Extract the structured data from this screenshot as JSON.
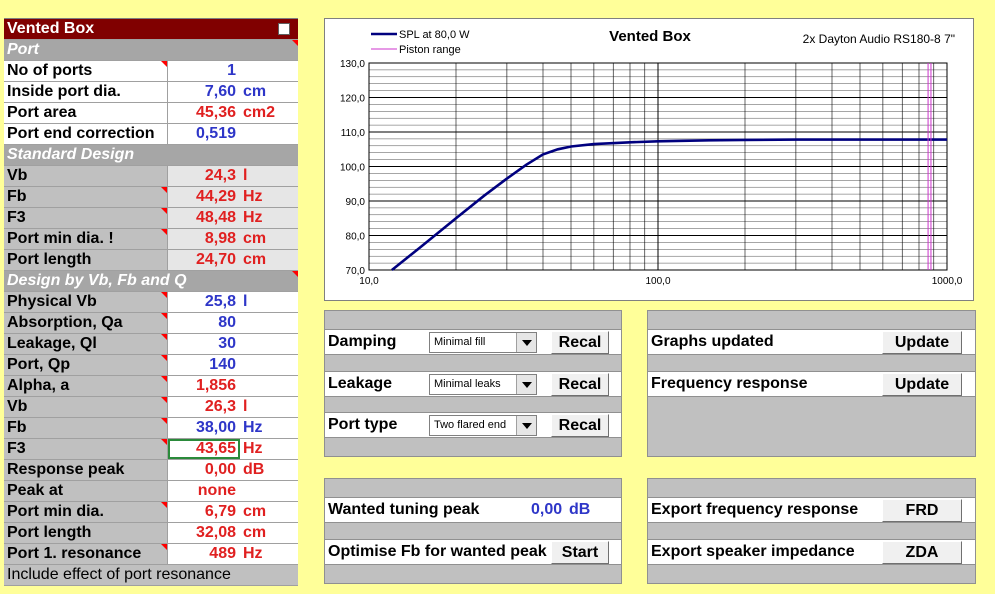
{
  "table": {
    "title": "Vented Box",
    "sections": {
      "port": "Port",
      "standard": "Standard Design",
      "design": "Design by Vb, Fb and Q"
    },
    "rows": [
      {
        "label": "No of ports",
        "value": "1",
        "unit": ""
      },
      {
        "label": "Inside port dia.",
        "value": "7,60",
        "unit": "cm"
      },
      {
        "label": "Port area",
        "value": "45,36",
        "unit": "cm2"
      },
      {
        "label": "Port end correction",
        "value": "0,519",
        "unit": ""
      },
      {
        "label": "Vb",
        "value": "24,3",
        "unit": "l"
      },
      {
        "label": "Fb",
        "value": "44,29",
        "unit": "Hz"
      },
      {
        "label": "F3",
        "value": "48,48",
        "unit": "Hz"
      },
      {
        "label": "Port min dia. !",
        "value": "8,98",
        "unit": "cm"
      },
      {
        "label": "Port length",
        "value": "24,70",
        "unit": "cm"
      },
      {
        "label": "Physical Vb",
        "value": "25,8",
        "unit": "l"
      },
      {
        "label": "Absorption, Qa",
        "value": "80",
        "unit": ""
      },
      {
        "label": "Leakage, Ql",
        "value": "30",
        "unit": ""
      },
      {
        "label": "Port, Qp",
        "value": "140",
        "unit": ""
      },
      {
        "label": "Alpha, a",
        "value": "1,856",
        "unit": ""
      },
      {
        "label": "Vb",
        "value": "26,3",
        "unit": "l"
      },
      {
        "label": "Fb",
        "value": "38,00",
        "unit": "Hz"
      },
      {
        "label": "F3",
        "value": "43,65",
        "unit": "Hz"
      },
      {
        "label": "Response peak",
        "value": "0,00",
        "unit": "dB"
      },
      {
        "label": "Peak at",
        "value": "none",
        "unit": ""
      },
      {
        "label": "Port min dia.",
        "value": "6,79",
        "unit": "cm"
      },
      {
        "label": "Port length",
        "value": "32,08",
        "unit": "cm"
      },
      {
        "label": "Port 1. resonance",
        "value": "489",
        "unit": "Hz"
      }
    ],
    "include_label": "Include effect of port resonance"
  },
  "chart": {
    "title": "Vented Box",
    "subtitle": "2x Dayton Audio RS180-8 7\"",
    "legend": [
      "SPL at 80,0 W",
      "Piston range"
    ],
    "x_ticks": [
      "10,0",
      "100,0",
      "1000,0"
    ],
    "y_ticks": [
      "130,0",
      "120,0",
      "110,0",
      "100,0",
      "90,0",
      "80,0",
      "70,0"
    ]
  },
  "chart_data": {
    "type": "line",
    "title": "Vented Box",
    "subtitle": "2x Dayton Audio RS180-8 7\"",
    "xscale": "log",
    "xlim": [
      10,
      1000
    ],
    "ylim": [
      70,
      130
    ],
    "grid": true,
    "legend_position": "top-left",
    "series": [
      {
        "name": "SPL at 80,0 W",
        "color": "#00007f",
        "x": [
          12,
          15,
          20,
          25,
          30,
          35,
          40,
          45,
          50,
          60,
          80,
          100,
          150,
          200,
          300,
          500,
          1000
        ],
        "y": [
          70,
          76.5,
          85,
          91.5,
          96.5,
          100.5,
          103.5,
          105.0,
          105.8,
          106.5,
          107.0,
          107.3,
          107.6,
          107.7,
          107.8,
          107.8,
          107.8
        ]
      },
      {
        "name": "Piston range",
        "color": "#cc33cc",
        "x": [
          860,
          880
        ],
        "y": [
          70,
          130
        ]
      }
    ]
  },
  "controls": {
    "damping": {
      "label": "Damping",
      "value": "Minimal fill",
      "button": "Recal"
    },
    "leakage": {
      "label": "Leakage",
      "value": "Minimal leaks",
      "button": "Recal"
    },
    "port_type": {
      "label": "Port type",
      "value": "Two flared end",
      "button": "Recal"
    },
    "graphs": {
      "label": "Graphs updated",
      "button": "Update"
    },
    "freq": {
      "label": "Frequency response",
      "button": "Update"
    },
    "wanted": {
      "label": "Wanted tuning peak",
      "value": "0,00",
      "unit": "dB"
    },
    "optimise": {
      "label": "Optimise Fb for wanted peak",
      "button": "Start"
    },
    "export_frd": {
      "label": "Export frequency response",
      "button": "FRD"
    },
    "export_zda": {
      "label": "Export speaker impedance",
      "button": "ZDA"
    }
  }
}
